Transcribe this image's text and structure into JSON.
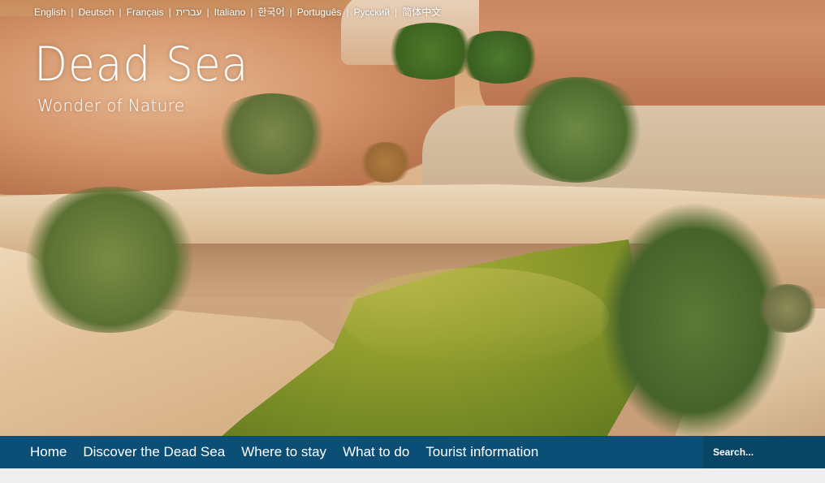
{
  "languages": [
    {
      "label": "English"
    },
    {
      "label": "Deutsch"
    },
    {
      "label": "Français"
    },
    {
      "label": "עברית"
    },
    {
      "label": "Italiano"
    },
    {
      "label": "한국어"
    },
    {
      "label": "Português"
    },
    {
      "label": "Русский"
    },
    {
      "label": "简体中文"
    }
  ],
  "language_separator": "|",
  "logo": {
    "title": "Dead Sea",
    "tagline": "Wonder of Nature"
  },
  "nav": {
    "items": [
      {
        "label": "Home"
      },
      {
        "label": "Discover the Dead Sea"
      },
      {
        "label": "Where to stay"
      },
      {
        "label": "What to do"
      },
      {
        "label": "Tourist information"
      }
    ],
    "search_placeholder": "Search...",
    "background_color": "#0b4f76"
  },
  "hero": {
    "image_subject": "desert canyon with green pond and rocky ledge"
  }
}
